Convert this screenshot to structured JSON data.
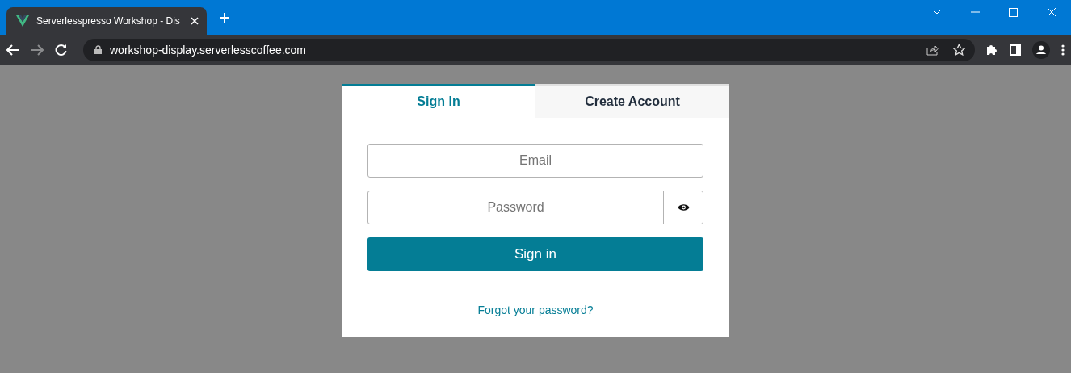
{
  "browser": {
    "tab_title": "Serverlesspresso Workshop - Dis",
    "url": "workshop-display.serverlesscoffee.com"
  },
  "auth": {
    "tabs": [
      {
        "label": "Sign In",
        "selected": true
      },
      {
        "label": "Create Account",
        "selected": false
      }
    ],
    "email": {
      "placeholder": "Email"
    },
    "password": {
      "placeholder": "Password"
    },
    "submit": "Sign in",
    "forgot_link": "Forgot your password?"
  }
}
